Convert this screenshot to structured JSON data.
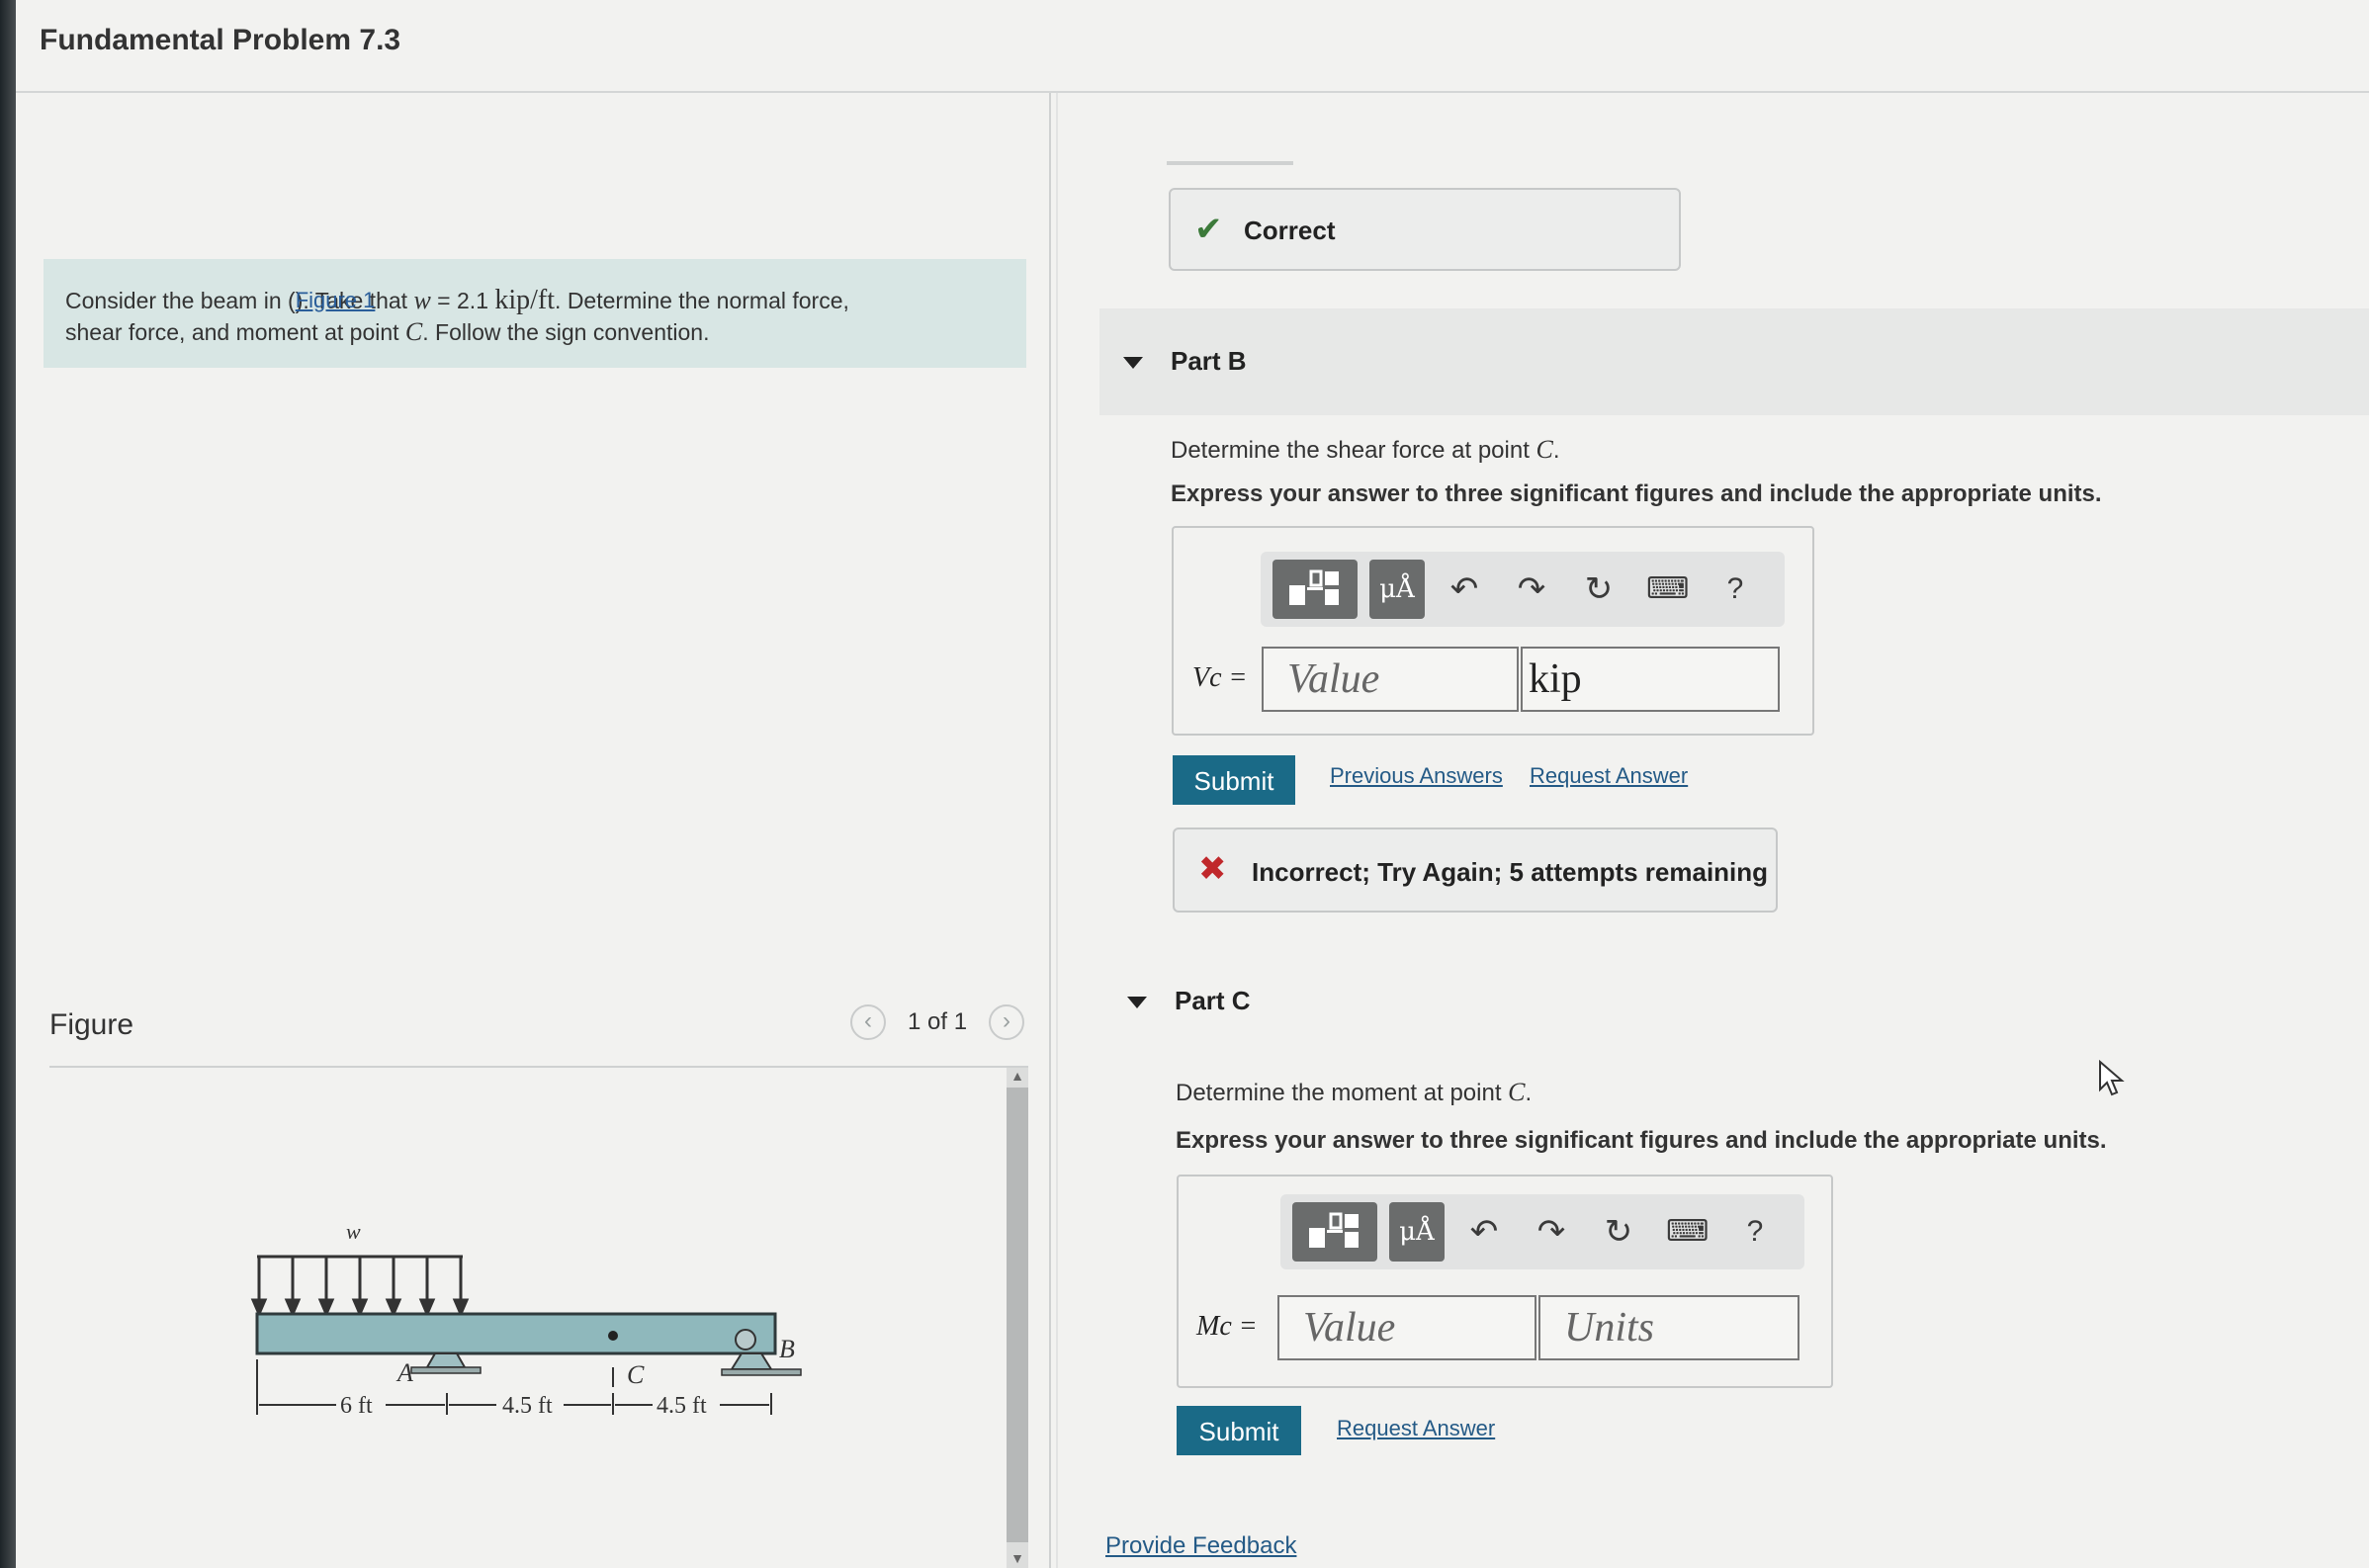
{
  "page": {
    "title": "Fundamental Problem 7.3"
  },
  "problem": {
    "text_before_link": "Consider the beam in (",
    "link_text": "Figure 1",
    "text_after_link": "). Take that ",
    "w_symbol": "w",
    "w_value": " = 2.1 ",
    "w_units": "kip/ft",
    "text_mid": ". Determine the normal force,",
    "line2_before": "shear force, and moment at point ",
    "point": "C",
    "line2_after": ". Follow the sign convention."
  },
  "figure": {
    "label": "Figure",
    "pager": "1 of 1",
    "prev_icon": "chevron-left-icon",
    "next_icon": "chevron-right-icon",
    "beam": {
      "load_label": "w",
      "point_a": "A",
      "point_b": "B",
      "point_c": "C",
      "dims": [
        "6 ft",
        "4.5 ft",
        "4.5 ft"
      ],
      "beam_color": "#8fb8bc"
    }
  },
  "partA_feedback": {
    "text": "Correct",
    "icon": "check-icon",
    "color": "#3c7a3a"
  },
  "partB": {
    "header": "Part B",
    "question_prefix": "Determine the shear force at point ",
    "question_point": "C",
    "question_suffix": ".",
    "instructions": "Express your answer to three significant figures and include the appropriate units.",
    "var_label": "Vc =",
    "value_placeholder": "Value",
    "units_value": "kip",
    "submit": "Submit",
    "previous_answers": "Previous Answers",
    "request_answer": "Request Answer",
    "feedback": {
      "text": "Incorrect; Try Again; 5 attempts remaining",
      "icon": "x-icon",
      "color": "#c0282b"
    }
  },
  "partC": {
    "header": "Part C",
    "question_prefix": "Determine the moment at point ",
    "question_point": "C",
    "question_suffix": ".",
    "instructions": "Express your answer to three significant figures and include the appropriate units.",
    "var_label": "Mc =",
    "value_placeholder": "Value",
    "units_placeholder": "Units",
    "submit": "Submit",
    "request_answer": "Request Answer"
  },
  "toolbar": {
    "units_label": "μÅ",
    "help": "?",
    "icons": [
      "templates-icon",
      "units-icon",
      "undo-icon",
      "redo-icon",
      "reset-icon",
      "keyboard-icon",
      "help-icon"
    ]
  },
  "footer": {
    "provide_feedback": "Provide Feedback"
  },
  "colors": {
    "submit": "#1a6a87",
    "problem_bg": "#d8e6e4",
    "link": "#245a86"
  }
}
